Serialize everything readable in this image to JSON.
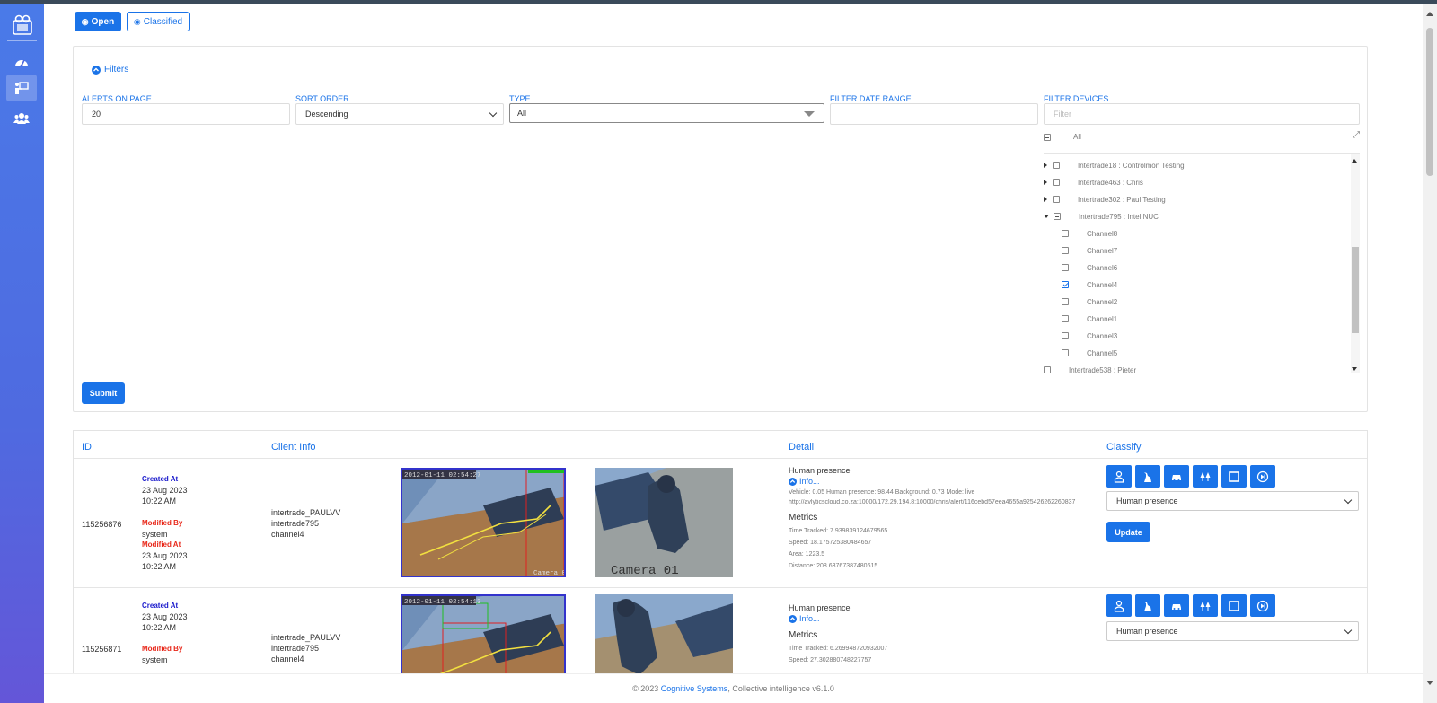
{
  "sidebar": {
    "items": [
      {
        "icon": "dashboard-icon",
        "active": false
      },
      {
        "icon": "alerts-icon",
        "active": true
      },
      {
        "icon": "users-icon",
        "active": false
      }
    ]
  },
  "tabs": {
    "open_label": "Open",
    "classified_label": "Classified"
  },
  "filters": {
    "toggle_label": "Filters",
    "alerts_on_page_label": "ALERTS ON PAGE",
    "alerts_on_page_value": "20",
    "sort_order_label": "SORT ORDER",
    "sort_order_value": "Descending",
    "type_label": "TYPE",
    "type_value": "All",
    "date_range_label": "FILTER DATE RANGE",
    "date_range_value": "",
    "devices_label": "FILTER DEVICES",
    "devices_placeholder": "Filter",
    "tree_all_label": "All",
    "tree": [
      "Intertrade18 : Controlmon Testing",
      "Intertrade463 : Chris",
      "Intertrade302 : Paul Testing",
      "Intertrade795 : Intel NUC",
      "Channel8",
      "Channel7",
      "Channel6",
      "Channel4",
      "Channel2",
      "Channel1",
      "Channel3",
      "Channel5",
      "Intertrade538 : Pieter"
    ],
    "submit_label": "Submit"
  },
  "table": {
    "headers": {
      "id": "ID",
      "client": "Client Info",
      "detail": "Detail",
      "classify": "Classify"
    },
    "rows": [
      {
        "id": "115256876",
        "created_label": "Created At",
        "created_date": "23 Aug 2023",
        "created_time": "10:22 AM",
        "modified_by_label": "Modified By",
        "modified_by": "system",
        "modified_at_label": "Modified At",
        "modified_date": "23 Aug 2023",
        "modified_time": "10:22 AM",
        "client": [
          "intertrade_PAULVV",
          "intertrade795",
          "channel4"
        ],
        "img_timestamp": "2012-01-11 02:54:27",
        "img_label": "Camera 01",
        "detail_title": "Human presence",
        "info_label": "Info...",
        "scores": "Vehicle: 0.05 Human presence: 98.44 Background: 0.73 Mode: live",
        "url": "http://avlyticscloud.co.za:10000/172.29.194.8:10000/chris/alert/116cebd57eea4655a925426262260837",
        "metrics_label": "Metrics",
        "metrics": [
          "Time Tracked: 7.939839124679565",
          "Speed: 18.175725380484657",
          "Area: 1223.5",
          "Distance: 208.63767387480615"
        ],
        "classification": "Human presence",
        "update_label": "Update"
      },
      {
        "id": "115256871",
        "created_label": "Created At",
        "created_date": "23 Aug 2023",
        "created_time": "10:22 AM",
        "modified_by_label": "Modified By",
        "modified_by": "system",
        "client": [
          "intertrade_PAULVV",
          "intertrade795",
          "channel4"
        ],
        "img_timestamp": "2012-01-11 02:54:13",
        "detail_title": "Human presence",
        "info_label": "Info...",
        "metrics_label": "Metrics",
        "metrics": [
          "Time Tracked: 6.269948720932007",
          "Speed: 27.302880748227757"
        ],
        "classification": "Human presence"
      }
    ]
  },
  "footer": {
    "prefix": "© 2023 ",
    "company": "Cognitive Systems",
    "suffix": ", Collective intelligence v6.1.0"
  },
  "colors": {
    "accent": "#1a73e8",
    "sidebar_top": "#4a7ae8",
    "sidebar_bottom": "#6456d8",
    "created": "#1a1acc",
    "modified": "#e8281a"
  }
}
